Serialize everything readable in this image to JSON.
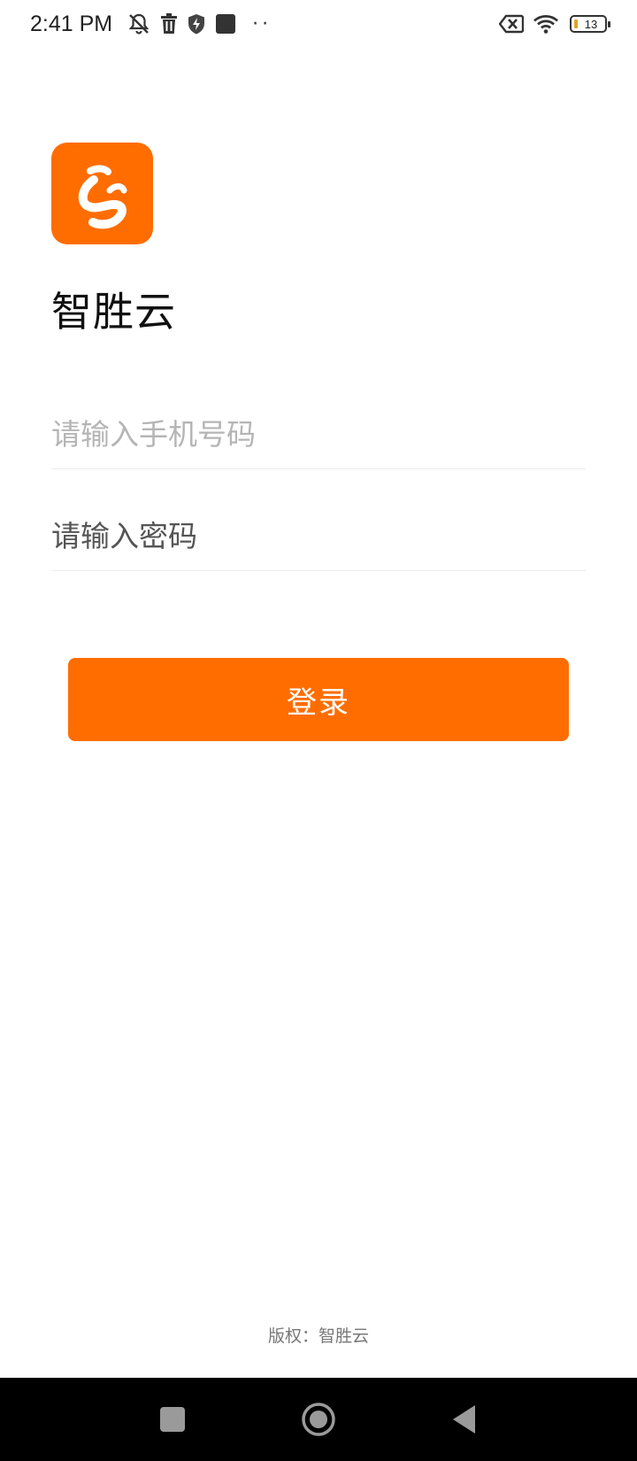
{
  "status_bar": {
    "time": "2:41 PM",
    "battery_level": "13",
    "icons": [
      "mute-bell-icon",
      "trash-icon",
      "shield-icon",
      "app-square-icon",
      "more-dots-icon",
      "no-sim-icon",
      "wifi-icon",
      "battery-icon"
    ]
  },
  "app": {
    "name": "智胜云",
    "logo_color": "#ff6d00"
  },
  "login_form": {
    "phone_placeholder": "请输入手机号码",
    "password_placeholder": "请输入密码",
    "login_label": "登录"
  },
  "footer": {
    "copyright": "版权：智胜云"
  },
  "nav_bar": {
    "icons": [
      "recents-icon",
      "home-icon",
      "back-icon"
    ]
  }
}
